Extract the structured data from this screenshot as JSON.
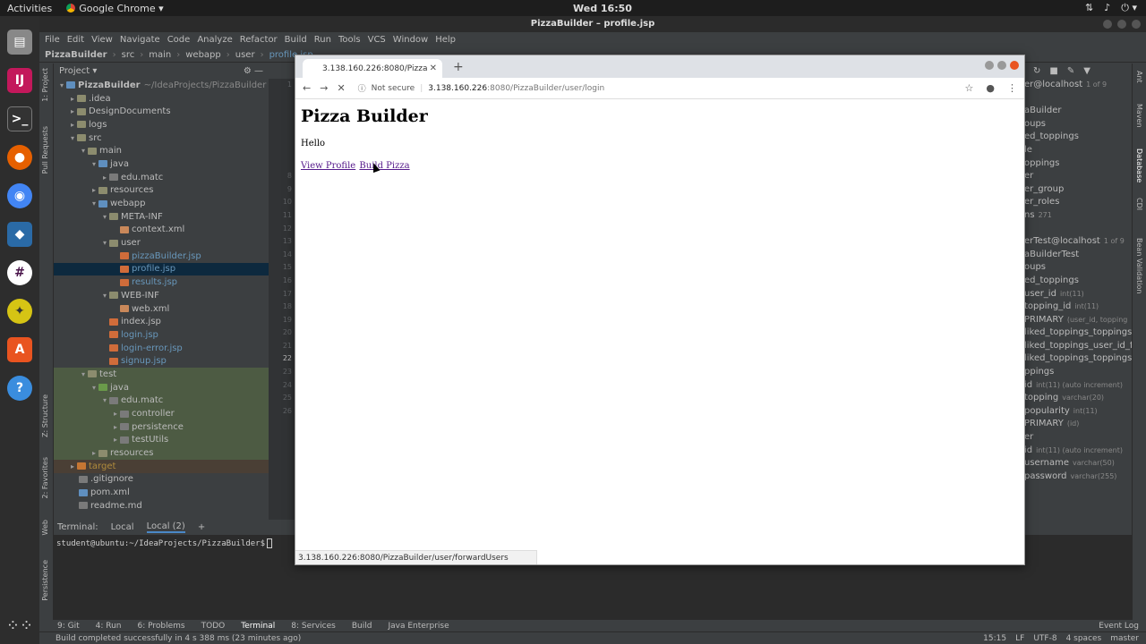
{
  "topbar": {
    "activities": "Activities",
    "app_name": "Google Chrome ▾",
    "clock": "Wed 16:50"
  },
  "ide": {
    "title": "PizzaBuilder – profile.jsp",
    "menu": [
      "File",
      "Edit",
      "View",
      "Navigate",
      "Code",
      "Analyze",
      "Refactor",
      "Build",
      "Run",
      "Tools",
      "VCS",
      "Window",
      "Help"
    ],
    "breadcrumb": [
      "PizzaBuilder",
      "src",
      "main",
      "webapp",
      "user",
      "profile.jsp"
    ],
    "project_label": "Project ▾",
    "project_root": "PizzaBuilder",
    "project_root_path": "~/IdeaProjects/PizzaBuilder",
    "tree": [
      {
        "label": ".idea"
      },
      {
        "label": "DesignDocuments"
      },
      {
        "label": "logs"
      },
      {
        "label": "src"
      },
      {
        "label": "main"
      },
      {
        "label": "java"
      },
      {
        "label": "edu.matc"
      },
      {
        "label": "resources"
      },
      {
        "label": "webapp"
      },
      {
        "label": "META-INF"
      },
      {
        "label": "context.xml"
      },
      {
        "label": "user"
      },
      {
        "label": "pizzaBuilder.jsp"
      },
      {
        "label": "profile.jsp"
      },
      {
        "label": "results.jsp"
      },
      {
        "label": "WEB-INF"
      },
      {
        "label": "web.xml"
      },
      {
        "label": "index.jsp"
      },
      {
        "label": "login.jsp"
      },
      {
        "label": "login-error.jsp"
      },
      {
        "label": "signup.jsp"
      },
      {
        "label": "test"
      },
      {
        "label": "java"
      },
      {
        "label": "edu.matc"
      },
      {
        "label": "controller"
      },
      {
        "label": "persistence"
      },
      {
        "label": "testUtils"
      },
      {
        "label": "resources"
      },
      {
        "label": "target"
      },
      {
        "label": ".gitignore"
      },
      {
        "label": "pom.xml"
      },
      {
        "label": "readme.md"
      }
    ],
    "gutter": [
      "1",
      "",
      "",
      "",
      "",
      "",
      "",
      "8",
      "9",
      "10",
      "11",
      "12",
      "13",
      "14",
      "15",
      "16",
      "17",
      "18",
      "19",
      "20",
      "21",
      "22",
      "23",
      "24",
      "25",
      "26"
    ],
    "db_panel": [
      {
        "text": "er@localhost",
        "dim": "1 of 9"
      },
      {
        "text": "",
        "dim": ""
      },
      {
        "text": "aBuilder",
        "dim": ""
      },
      {
        "text": "oups",
        "dim": ""
      },
      {
        "text": "ed_toppings",
        "dim": ""
      },
      {
        "text": "le",
        "dim": ""
      },
      {
        "text": "oppings",
        "dim": ""
      },
      {
        "text": "er",
        "dim": ""
      },
      {
        "text": "er_group",
        "dim": ""
      },
      {
        "text": "er_roles",
        "dim": ""
      },
      {
        "text": "ns",
        "dim": "271"
      },
      {
        "text": "",
        "dim": ""
      },
      {
        "text": "erTest@localhost",
        "dim": "1 of 9"
      },
      {
        "text": "aBuilderTest",
        "dim": ""
      },
      {
        "text": "oups",
        "dim": ""
      },
      {
        "text": "ed_toppings",
        "dim": ""
      },
      {
        "text": " user_id",
        "dim": "int(11)"
      },
      {
        "text": " topping_id",
        "dim": "int(11)"
      },
      {
        "text": " PRIMARY",
        "dim": "(user_id, topping"
      },
      {
        "text": " liked_toppings_toppings",
        "dim": ""
      },
      {
        "text": " liked_toppings_user_id_f",
        "dim": ""
      },
      {
        "text": " liked_toppings_toppings",
        "dim": ""
      },
      {
        "text": "ppings",
        "dim": ""
      },
      {
        "text": " id",
        "dim": "int(11) (auto increment)"
      },
      {
        "text": " topping",
        "dim": "varchar(20)"
      },
      {
        "text": " popularity",
        "dim": "int(11)"
      },
      {
        "text": " PRIMARY",
        "dim": "(id)"
      },
      {
        "text": "er",
        "dim": ""
      },
      {
        "text": " id",
        "dim": "int(11) (auto increment)"
      },
      {
        "text": " username",
        "dim": "varchar(50)"
      },
      {
        "text": " password",
        "dim": "varchar(255)"
      }
    ],
    "right_strip": [
      "Ant",
      "Maven",
      "Database",
      "CDI",
      "Bean Validation"
    ],
    "left_strip": [
      "1: Project",
      "Pull Requests",
      "Z: Structure",
      "2: Favorites",
      "Web",
      "Persistence"
    ],
    "terminal": {
      "label": "Terminal:",
      "tabs": [
        "Local",
        "Local (2)",
        "+"
      ],
      "prompt": "student@ubuntu:~/IdeaProjects/PizzaBuilder$"
    },
    "bottom_tools": [
      "9: Git",
      "4: Run",
      "6: Problems",
      "TODO",
      "Terminal",
      "8: Services",
      "Build",
      "Java Enterprise"
    ],
    "event_log": "Event Log",
    "status": "Build completed successfully in 4 s 388 ms (23 minutes ago)",
    "status_right": [
      "15:15",
      "LF",
      "UTF-8",
      "4 spaces",
      "master"
    ]
  },
  "chrome": {
    "tab_title": "3.138.160.226:8080/Pizza",
    "not_secure": "Not secure",
    "url_host": "3.138.160.226",
    "url_path": ":8080/PizzaBuilder/user/login",
    "page": {
      "heading": "Pizza Builder",
      "greeting": "Hello",
      "link_view_profile": "View Profile",
      "link_build_pizza": "Build Pizza"
    },
    "status_url": "3.138.160.226:8080/PizzaBuilder/user/forwardUsers"
  }
}
